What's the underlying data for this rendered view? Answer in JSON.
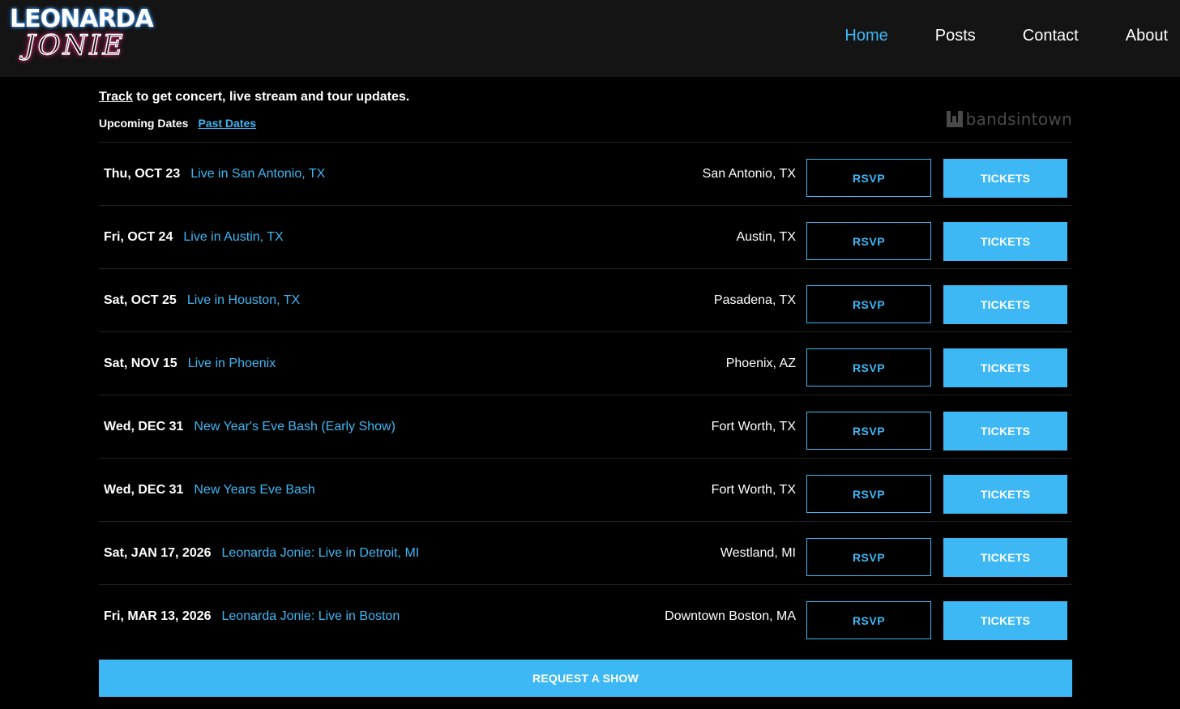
{
  "header": {
    "logo_top": "LEONARDA",
    "logo_bottom": "JONIE",
    "nav": [
      {
        "label": "Home",
        "active": true
      },
      {
        "label": "Posts",
        "active": false
      },
      {
        "label": "Contact",
        "active": false
      },
      {
        "label": "About",
        "active": false
      }
    ]
  },
  "track": {
    "link_label": "Track",
    "text": " to get concert, live stream and tour updates."
  },
  "tabs": {
    "upcoming": "Upcoming Dates",
    "past": "Past Dates"
  },
  "provider": {
    "name": "bandsintown",
    "icon": "bandsintown-icon"
  },
  "buttons": {
    "rsvp": "RSVP",
    "tickets": "TICKETS",
    "request": "REQUEST A SHOW"
  },
  "events": [
    {
      "date": "Thu, OCT 23",
      "title": "Live in San Antonio, TX",
      "venue": "San Antonio, TX"
    },
    {
      "date": "Fri, OCT 24",
      "title": "Live in Austin, TX",
      "venue": "Austin, TX"
    },
    {
      "date": "Sat, OCT 25",
      "title": "Live in Houston, TX",
      "venue": "Pasadena, TX"
    },
    {
      "date": "Sat, NOV 15",
      "title": "Live in Phoenix",
      "venue": "Phoenix, AZ"
    },
    {
      "date": "Wed, DEC 31",
      "title": "New Year's Eve Bash (Early Show)",
      "venue": "Fort Worth, TX"
    },
    {
      "date": "Wed, DEC 31",
      "title": "New Years Eve Bash",
      "venue": "Fort Worth, TX"
    },
    {
      "date": "Sat, JAN 17, 2026",
      "title": "Leonarda Jonie: Live in Detroit, MI",
      "venue": "Westland, MI"
    },
    {
      "date": "Fri, MAR 13, 2026",
      "title": "Leonarda Jonie: Live in Boston",
      "venue": "Downtown Boston, MA"
    }
  ],
  "colors": {
    "accent": "#3db8f5",
    "header_bg": "#141414",
    "page_bg": "#000000"
  }
}
